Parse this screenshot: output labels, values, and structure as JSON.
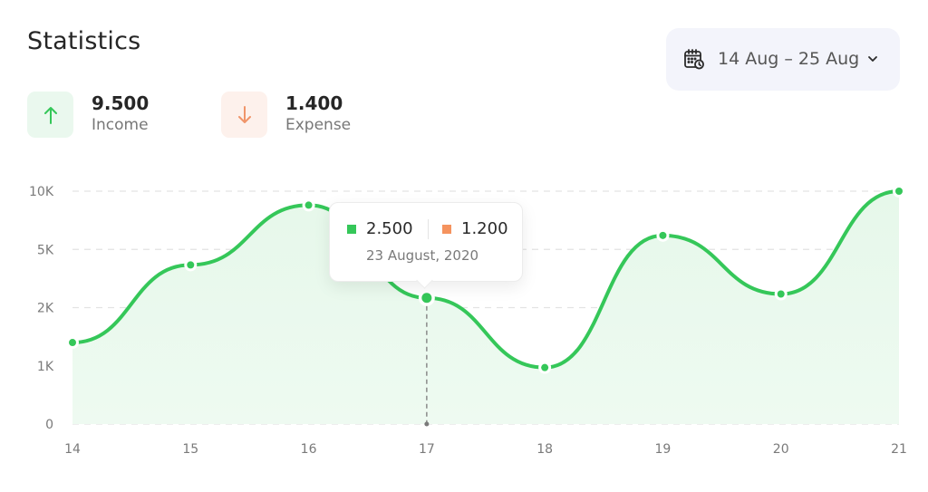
{
  "header": {
    "title": "Statistics",
    "date_range": "14 Aug – 25 Aug",
    "calendar_icon": "calendar-clock-icon",
    "dropdown_icon": "chevron-down-icon"
  },
  "summary": {
    "income": {
      "value": "9.500",
      "label": "Income",
      "icon": "arrow-up-icon",
      "color": "#35c759",
      "bg": "#eaf8ee"
    },
    "expense": {
      "value": "1.400",
      "label": "Expense",
      "icon": "arrow-down-icon",
      "color": "#f0956a",
      "bg": "#fdf1ec"
    }
  },
  "tooltip": {
    "income_value": "2.500",
    "expense_value": "1.200",
    "date": "23 August, 2020",
    "income_color": "#35c759",
    "expense_color": "#f5935e"
  },
  "chart_data": {
    "type": "area",
    "title": "",
    "xlabel": "",
    "ylabel": "",
    "x": [
      "14",
      "15",
      "16",
      "17",
      "18",
      "19",
      "20",
      "21"
    ],
    "y_ticks": [
      "0",
      "1K",
      "2K",
      "5K",
      "10K"
    ],
    "y_tick_values": [
      0,
      1000,
      2000,
      5000,
      10000
    ],
    "ylim": [
      0,
      10000
    ],
    "y_scale": "piecewise (equal spacing between ticks)",
    "grid": true,
    "series": [
      {
        "name": "Income",
        "color": "#35c759",
        "values": [
          1400,
          4200,
          8800,
          2500,
          970,
          6200,
          2700,
          10000
        ]
      }
    ],
    "highlighted_index": 3,
    "legend": "none"
  }
}
